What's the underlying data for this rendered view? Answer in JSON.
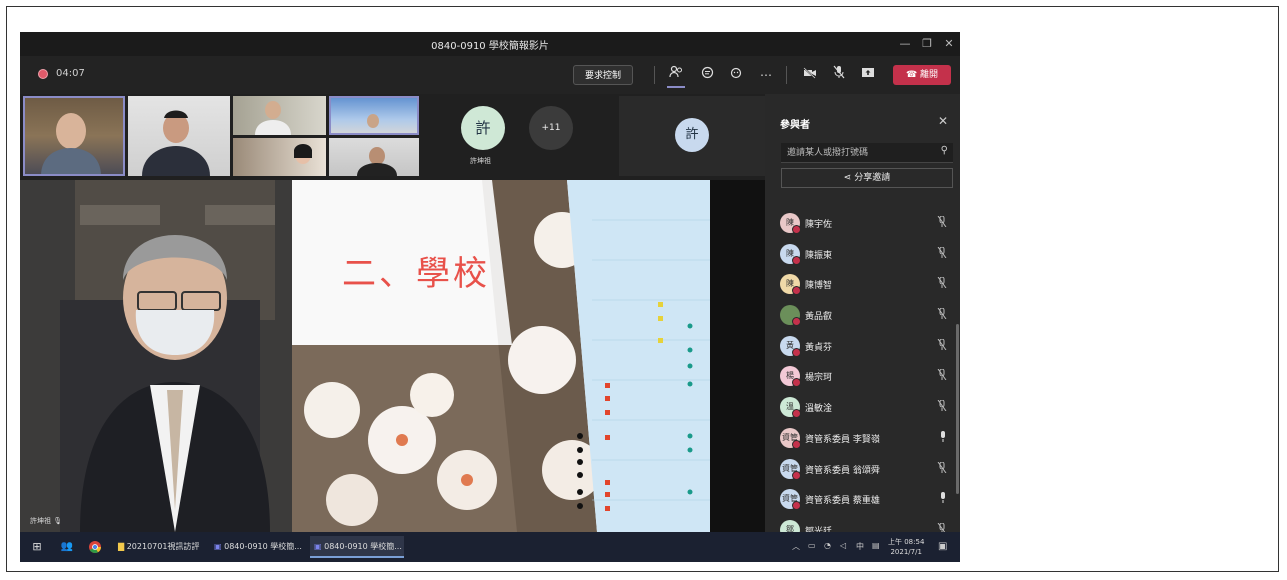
{
  "window": {
    "title": "0840-0910 學校簡報影片"
  },
  "toolbar": {
    "timer": "04:07",
    "request_control_label": "要求控制",
    "leave_label": "離開"
  },
  "thumbnails": {
    "avatar_initial": "許",
    "avatar_name": "許坤祖",
    "more_count": "+11",
    "avatar2_initial": "許"
  },
  "stage": {
    "speaker_name": "許坤祖",
    "slide_title": "二、學校"
  },
  "panel": {
    "title": "參與者",
    "search_placeholder": "邀請某人或撥打號碼",
    "share_label": "分享邀請",
    "participants": [
      {
        "initial": "陳",
        "name": "陳宇佐",
        "color": "#e9c8c8",
        "mic": "muted"
      },
      {
        "initial": "陳",
        "name": "陳振東",
        "color": "#c8d9ee",
        "mic": "muted"
      },
      {
        "initial": "陳",
        "name": "陳博智",
        "color": "#f0d9a8",
        "mic": "muted"
      },
      {
        "initial": "",
        "name": "黃品叡",
        "color": "#6b8f5a",
        "mic": "muted"
      },
      {
        "initial": "黃",
        "name": "黃貞芬",
        "color": "#c8d9ee",
        "mic": "muted"
      },
      {
        "initial": "楊",
        "name": "楊宗珂",
        "color": "#f3c9d6",
        "mic": "muted"
      },
      {
        "initial": "溫",
        "name": "溫敏淦",
        "color": "#cde9d6",
        "mic": "muted"
      },
      {
        "initial": "資管",
        "name": "資管系委員 李賢嶺",
        "color": "#e9c8c8",
        "mic": "on"
      },
      {
        "initial": "資管",
        "name": "資管系委員 翁頌舜",
        "color": "#c8d9ee",
        "mic": "muted"
      },
      {
        "initial": "資管",
        "name": "資管系委員 蔡重雄",
        "color": "#c8d9ee",
        "mic": "on"
      },
      {
        "initial": "鄒",
        "name": "鄒光廷",
        "color": "#cde9d6",
        "mic": "muted"
      }
    ]
  },
  "taskbar": {
    "items": [
      "20210701視訊訪評",
      "0840-0910 學校簡...",
      "0840-0910 學校簡..."
    ],
    "clock_time": "上午 08:54",
    "clock_date": "2021/7/1"
  }
}
